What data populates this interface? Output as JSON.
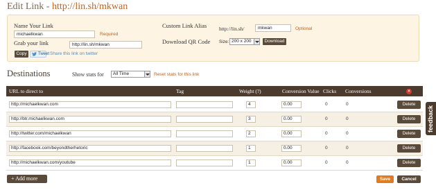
{
  "title": {
    "prefix": "Edit Link - ",
    "url": "http://lin.sh/mkwan"
  },
  "form": {
    "name_label": "Name Your Link",
    "name_value": "michaelkwan",
    "name_required": "Required",
    "grab_label": "Grab your link",
    "grab_value": "http://lin.sh/mkwan",
    "copy_label": "Copy",
    "tweet_label": "Tweet",
    "share_label": "Share this link on twitter",
    "alias_label": "Custom Link Alias",
    "alias_prefix": "http://lin.sh/",
    "alias_value": "mkwan",
    "alias_optional": "Optional",
    "qr_label": "Download QR Code",
    "size_label": "Size:",
    "size_value": "200 x 200",
    "download_label": "Download"
  },
  "destinations": {
    "title": "Destinations",
    "stats_label": "Show stats for",
    "stats_value": "All Time",
    "reset_label": "Reset stats for this link",
    "columns": [
      "URL to direct to",
      "Tag",
      "Weight (?)",
      "Conversion Value",
      "Clicks",
      "Conversions"
    ],
    "rows": [
      {
        "url": "http://michaelkwan.com",
        "tag": "",
        "weight": "4",
        "conv_value": "0.00",
        "clicks": "0",
        "conversions": "0"
      },
      {
        "url": "http://btr.michaelkwan.com",
        "tag": "",
        "weight": "3",
        "conv_value": "0.00",
        "clicks": "0",
        "conversions": "0"
      },
      {
        "url": "http://twitter.com/michaelkwan",
        "tag": "",
        "weight": "2",
        "conv_value": "0.00",
        "clicks": "0",
        "conversions": "0"
      },
      {
        "url": "http://facebook.com/beyondtherhetoric",
        "tag": "",
        "weight": "1",
        "conv_value": "0.00",
        "clicks": "0",
        "conversions": "0"
      },
      {
        "url": "http://michaelkwan.com/youtube",
        "tag": "",
        "weight": "1",
        "conv_value": "0.00",
        "clicks": "0",
        "conversions": "0"
      }
    ],
    "delete_label": "Delete"
  },
  "footer": {
    "add_more": "+ Add more",
    "save": "Save",
    "cancel": "Cancel"
  },
  "feedback": "feedback",
  "colors": {
    "accent_orange": "#e07b1e",
    "dark_brown": "#4b3b2f",
    "panel_bg": "#fdf4e4",
    "link_orange": "#c2611f"
  }
}
